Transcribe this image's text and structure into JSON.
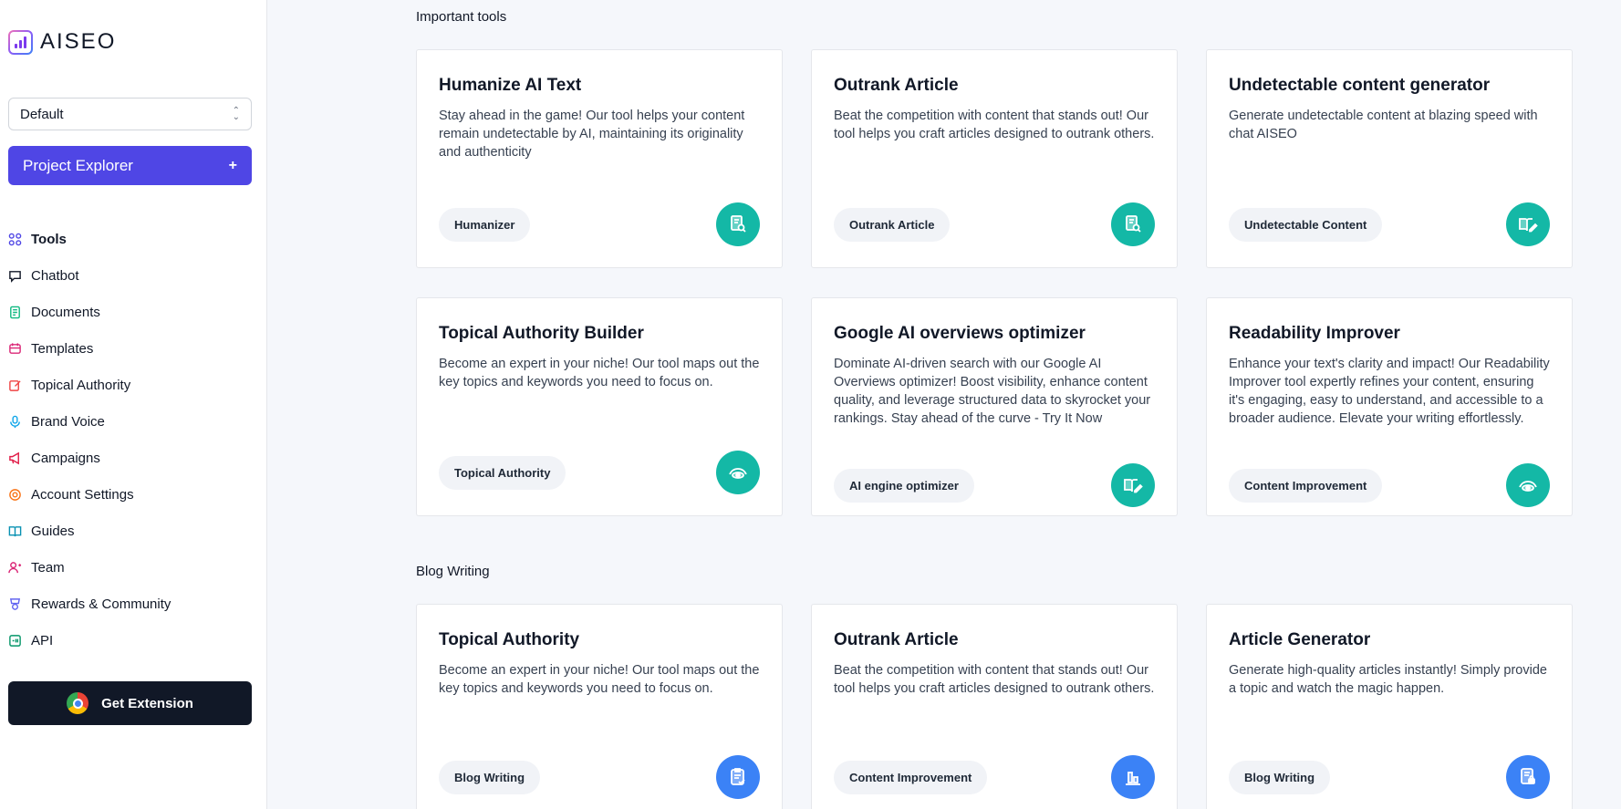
{
  "app": {
    "logo_text": "AISEO",
    "project_select": "Default",
    "project_explorer_label": "Project Explorer",
    "project_explorer_plus": "+",
    "get_extension_label": "Get Extension"
  },
  "nav": [
    {
      "label": "Tools",
      "icon": "grid-icon",
      "color": "#4f46e5"
    },
    {
      "label": "Chatbot",
      "icon": "chat-icon",
      "color": "#111827"
    },
    {
      "label": "Documents",
      "icon": "document-icon",
      "color": "#10b981"
    },
    {
      "label": "Templates",
      "icon": "template-icon",
      "color": "#db2777"
    },
    {
      "label": "Topical Authority",
      "icon": "edit-icon",
      "color": "#ef4444"
    },
    {
      "label": "Brand Voice",
      "icon": "mic-icon",
      "color": "#0ea5e9"
    },
    {
      "label": "Campaigns",
      "icon": "megaphone-icon",
      "color": "#e11d48"
    },
    {
      "label": "Account Settings",
      "icon": "settings-icon",
      "color": "#f97316"
    },
    {
      "label": "Guides",
      "icon": "book-icon",
      "color": "#0891b2"
    },
    {
      "label": "Team",
      "icon": "user-icon",
      "color": "#db2777"
    },
    {
      "label": "Rewards & Community",
      "icon": "trophy-icon",
      "color": "#6366f1"
    },
    {
      "label": "API",
      "icon": "api-icon",
      "color": "#059669"
    }
  ],
  "sections": {
    "important": "Important tools",
    "blog": "Blog Writing"
  },
  "cards": [
    {
      "title": "Humanize AI Text",
      "desc": "Stay ahead in the game! Our tool helps your content remain undetectable by AI, maintaining its originality and authenticity",
      "tag": "Humanizer",
      "icon": "doc-search-icon",
      "color": "teal"
    },
    {
      "title": "Outrank Article",
      "desc": "Beat the competition with content that stands out! Our tool helps you craft articles designed to outrank others.",
      "tag": "Outrank Article",
      "icon": "doc-search-icon",
      "color": "teal"
    },
    {
      "title": "Undetectable content generator",
      "desc": "Generate undetectable content at blazing speed with chat AISEO",
      "tag": "Undetectable Content",
      "icon": "book-pen-icon",
      "color": "teal"
    },
    {
      "title": "Topical Authority Builder",
      "desc": "Become an expert in your niche! Our tool maps out the key topics and keywords you need to focus on.",
      "tag": "Topical Authority",
      "icon": "eye-icon",
      "color": "teal"
    },
    {
      "title": "Google AI overviews optimizer",
      "desc": "Dominate AI-driven search with our Google AI Overviews optimizer! Boost visibility, enhance content quality, and leverage structured data to skyrocket your rankings. Stay ahead of the curve - Try It Now",
      "tag": "AI engine optimizer",
      "icon": "book-pen-icon",
      "color": "teal"
    },
    {
      "title": "Readability Improver",
      "desc": "Enhance your text's clarity and impact! Our Readability Improver tool expertly refines your content, ensuring it's engaging, easy to understand, and accessible to a broader audience. Elevate your writing effortlessly.",
      "tag": "Content Improvement",
      "icon": "eye-icon",
      "color": "teal"
    },
    {
      "title": "Topical Authority",
      "desc": "Become an expert in your niche! Our tool maps out the key topics and keywords you need to focus on.",
      "tag": "Blog Writing",
      "icon": "clipboard-check-icon",
      "color": "blue"
    },
    {
      "title": "Outrank Article",
      "desc": "Beat the competition with content that stands out! Our tool helps you craft articles designed to outrank others.",
      "tag": "Content Improvement",
      "icon": "chart-icon",
      "color": "blue"
    },
    {
      "title": "Article Generator",
      "desc": "Generate high-quality articles instantly! Simply provide a topic and watch the magic happen.",
      "tag": "Blog Writing",
      "icon": "doc-lock-icon",
      "color": "blue"
    }
  ]
}
